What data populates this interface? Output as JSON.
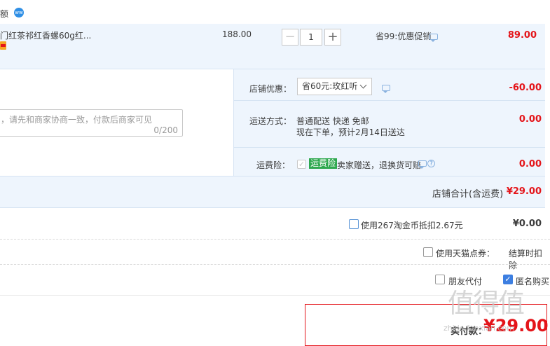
{
  "store": {
    "name_fragment": "额",
    "badge": "ww"
  },
  "item": {
    "title": "门红茶祁红香螺60g红...",
    "price": "188.00",
    "quantity": "1",
    "promo": "省99:优惠促销",
    "subtotal": "89.00"
  },
  "shop_promo": {
    "label": "店铺优惠：",
    "selected": "省60元:玫红听",
    "amount": "-60.00"
  },
  "message": {
    "placeholder": "，请先和商家协商一致，付款后商家可见",
    "counter": "0/200"
  },
  "shipping": {
    "label": "运送方式：",
    "method": "普通配送 快递 免邮",
    "eta": "现在下单，预计2月14日送达",
    "amount": "0.00"
  },
  "insurance": {
    "label": "运费险：",
    "tag": "运费险",
    "desc": "卖家赠送，退换货可赔",
    "amount": "0.00",
    "help": "?"
  },
  "shop_total": {
    "label": "店铺合计(含运费)",
    "amount": "¥29.00"
  },
  "coins": {
    "label": "使用267淘金币抵扣2.67元",
    "amount": "¥0.00"
  },
  "tmall_points": {
    "label": "使用天猫点券：",
    "note": "结算时扣除"
  },
  "options": {
    "friend_pay": "朋友代付",
    "anonymous": "匿名购买"
  },
  "payment": {
    "label": "实付款：",
    "amount": "¥29.00"
  },
  "watermark": {
    "text": "值得值",
    "site": "zhide.fanxian.com"
  },
  "colors": {
    "accent_red": "#e4151a",
    "panel_blue": "#eef5fd",
    "check_blue": "#3d7fe1",
    "insurance_green": "#2fa84f"
  }
}
